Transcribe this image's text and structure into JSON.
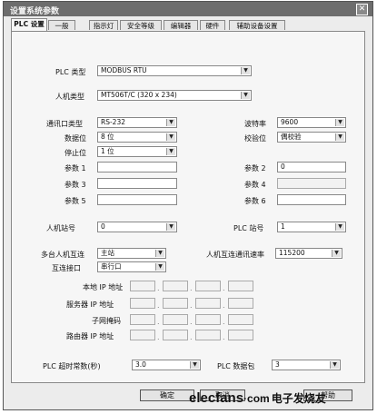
{
  "window": {
    "title": "设置系统参数",
    "close_icon": "close-icon"
  },
  "tabs": [
    "PLC 设置",
    "一般",
    "指示灯",
    "安全等级",
    "编辑器",
    "硬件",
    "辅助设备设置"
  ],
  "plc_type": {
    "label": "PLC 类型",
    "value": "MODBUS RTU"
  },
  "hmi_type": {
    "label": "人机类型",
    "value": "MT506T/C (320 x 234)"
  },
  "comm": {
    "port_type": {
      "label": "通讯口类型",
      "value": "RS-232"
    },
    "baud_rate": {
      "label": "波特率",
      "value": "9600"
    },
    "data_bits": {
      "label": "数据位",
      "value": "8 位"
    },
    "parity": {
      "label": "校验位",
      "value": "偶校验"
    },
    "stop_bits": {
      "label": "停止位",
      "value": "1 位"
    }
  },
  "params": [
    {
      "label": "参数 1",
      "value": ""
    },
    {
      "label": "参数 2",
      "value": "0"
    },
    {
      "label": "参数 3",
      "value": ""
    },
    {
      "label": "参数 4",
      "value": ""
    },
    {
      "label": "参数 5",
      "value": ""
    },
    {
      "label": "参数 6",
      "value": ""
    }
  ],
  "hmi_station": {
    "label": "人机站号",
    "value": "0"
  },
  "plc_station": {
    "label": "PLC 站号",
    "value": "1"
  },
  "multi_hmi": {
    "label": "多台人机互连",
    "value": "主站"
  },
  "hmi_link_rate": {
    "label": "人机互连通讯速率",
    "value": "115200"
  },
  "link_interface": {
    "label": "互连接口",
    "value": "串行口"
  },
  "network": {
    "local_ip": "本地 IP 地址",
    "server_ip": "服务器 IP 地址",
    "subnet_mask": "子网掩码",
    "router_ip": "路由器 IP 地址"
  },
  "plc_timeout": {
    "label": "PLC 超时常数(秒)",
    "value": "3.0"
  },
  "plc_packet": {
    "label": "PLC 数据包",
    "value": "3"
  },
  "buttons": {
    "ok": "确定",
    "cancel": "取消",
    "help": "帮助"
  },
  "watermark": {
    "brand": "elecfans",
    "domain": "·com",
    "cn": "电子发烧友"
  }
}
